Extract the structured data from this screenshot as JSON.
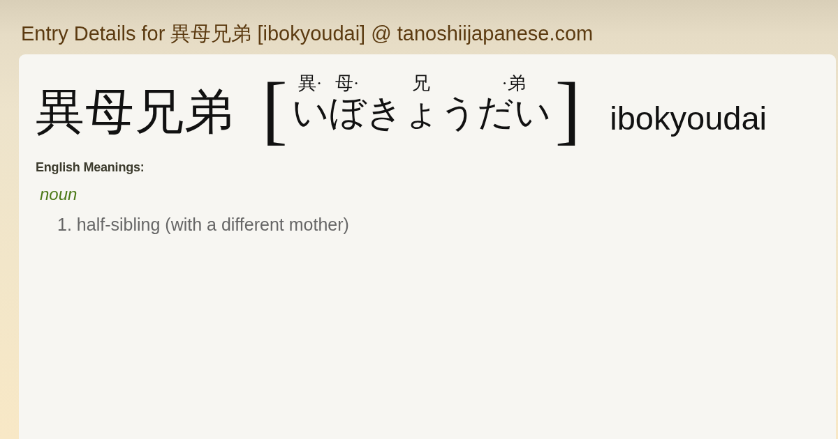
{
  "page_title": "Entry Details for 異母兄弟 [ibokyoudai] @ tanoshiijapanese.com",
  "entry": {
    "headword": "異母兄弟",
    "bracket_open": "[",
    "reading": [
      {
        "annotation": "異·",
        "kana": "い"
      },
      {
        "annotation": "母·",
        "kana": "ぼ"
      },
      {
        "annotation": "兄",
        "kana": "きょう"
      },
      {
        "annotation": "·弟",
        "kana": "だい"
      }
    ],
    "bracket_close": "]",
    "romaji": "ibokyoudai"
  },
  "meanings_label": "English Meanings:",
  "meanings": [
    {
      "part_of_speech": "noun",
      "senses": [
        {
          "number": "1.",
          "text": "half-sibling (with a different mother)"
        }
      ]
    }
  ]
}
